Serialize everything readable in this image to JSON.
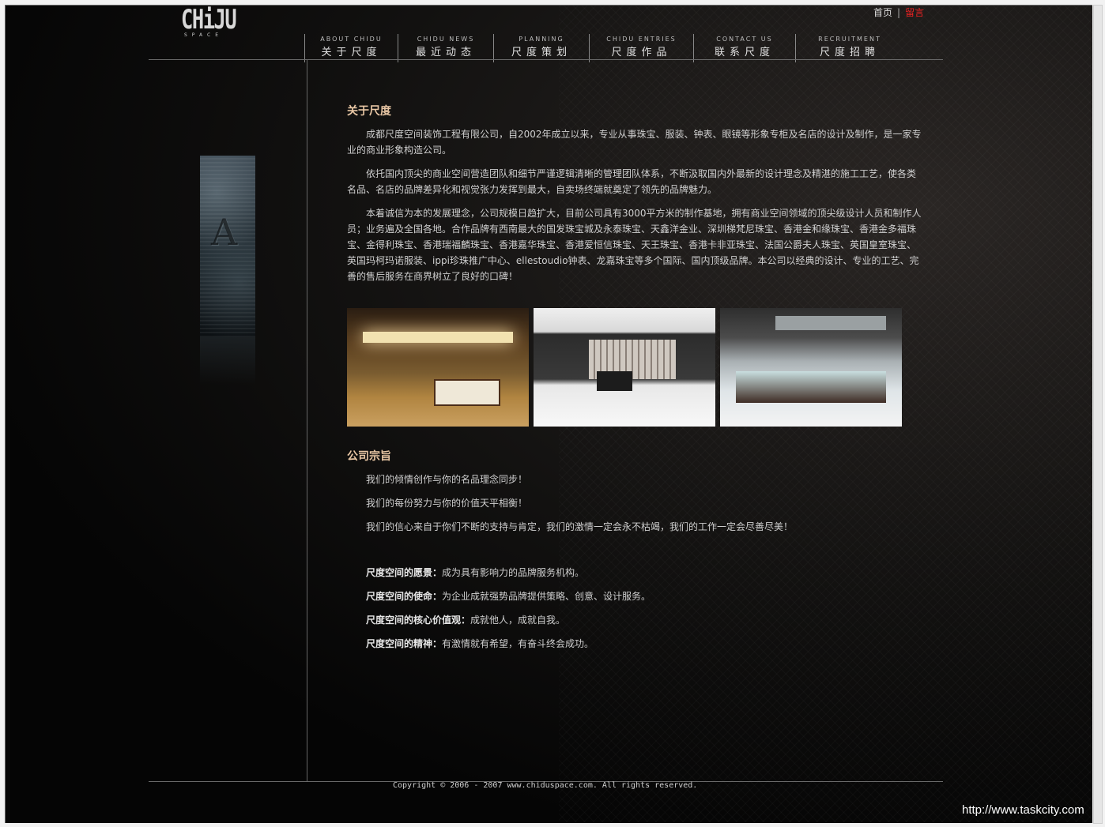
{
  "header": {
    "logo": {
      "mark": "CHiJU",
      "sub": "SPACE"
    },
    "toplinks": {
      "home": "首页",
      "separator": "|",
      "message": "留言"
    },
    "nav": [
      {
        "en": "ABOUT CHIDU",
        "zh": "关于尺度"
      },
      {
        "en": "CHIDU NEWS",
        "zh": "最近动态"
      },
      {
        "en": "PLANNING",
        "zh": "尺度策划"
      },
      {
        "en": "CHIDU ENTRIES",
        "zh": "尺度作品"
      },
      {
        "en": "CONTACT US",
        "zh": "联系尺度"
      },
      {
        "en": "RECRUITMENT",
        "zh": "尺度招聘"
      }
    ]
  },
  "about": {
    "title": "关于尺度",
    "paragraphs": [
      "成都尺度空间装饰工程有限公司，自2002年成立以来，专业从事珠宝、服装、钟表、眼镜等形象专柜及名店的设计及制作，是一家专业的商业形象构造公司。",
      "依托国内顶尖的商业空间营造团队和细节严谨逻辑清晰的管理团队体系，不断汲取国内外最新的设计理念及精湛的施工工艺，使各类名品、名店的品牌差异化和视觉张力发挥到最大，自卖场终端就奠定了领先的品牌魅力。",
      "本着诚信为本的发展理念，公司规模日趋扩大，目前公司具有3000平方米的制作基地，拥有商业空间领域的顶尖级设计人员和制作人员；业务遍及全国各地。合作品牌有西南最大的国发珠宝城及永泰珠宝、天鑫洋金业、深圳梯梵尼珠宝、香港金和缘珠宝、香港金多福珠宝、金得利珠宝、香港瑞福麟珠宝、香港嘉华珠宝、香港爱恒信珠宝、天王珠宝、香港卡非亚珠宝、法国公爵夫人珠宝、英国皇室珠宝、英国玛柯玛诺服装、ippi珍珠推广中心、ellestoudio钟表、龙嘉珠宝等多个国际、国内顶级品牌。本公司以经典的设计、专业的工艺、完善的售后服务在商界树立了良好的口碑！"
    ]
  },
  "tenets": {
    "title": "公司宗旨",
    "lines": [
      "我们的倾情创作与你的名品理念同步！",
      "我们的每份努力与你的价值天平相衡！",
      "我们的信心来自于你们不断的支持与肯定，我们的激情一定会永不枯竭，我们的工作一定会尽善尽美！"
    ],
    "values": [
      {
        "label": "尺度空间的愿景：",
        "text": "成为具有影响力的品牌服务机构。"
      },
      {
        "label": "尺度空间的使命：",
        "text": "为企业成就强势品牌提供策略、创意、设计服务。"
      },
      {
        "label": "尺度空间的核心价值观：",
        "text": "成就他人，成就自我。"
      },
      {
        "label": "尺度空间的精神：",
        "text": "有激情就有希望，有奋斗终会成功。"
      }
    ]
  },
  "footer": {
    "copyright": "Copyright © 2006 - 2007 www.chiduspace.com. All rights reserved."
  },
  "watermark": "http://www.taskcity.com",
  "colors": {
    "accent": "#e8c6a4",
    "link_red": "#e22222",
    "background": "#050505"
  }
}
